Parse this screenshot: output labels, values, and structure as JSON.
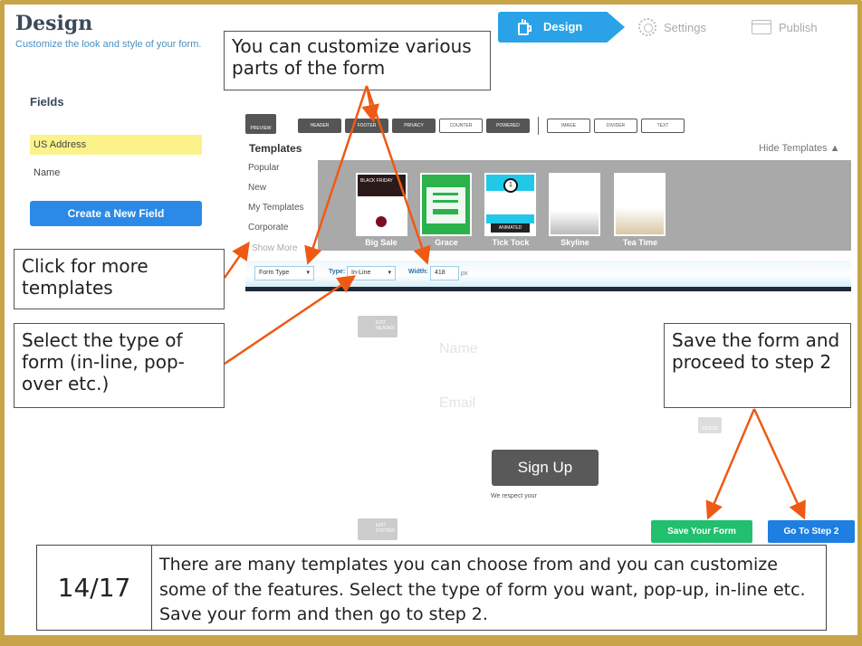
{
  "header": {
    "title": "Design",
    "subtitle": "Customize the look and style of your form."
  },
  "steps": {
    "design": "Design",
    "settings": "Settings",
    "publish": "Publish"
  },
  "callouts": {
    "customize": "You can customize various parts of the form",
    "more_templates": "Click for more templates",
    "form_type": "Select the type of form (in-line, pop-over etc.)",
    "save": "Save the form and proceed to step 2"
  },
  "fields": {
    "heading": "Fields",
    "items": [
      "US Address",
      "Name"
    ],
    "create_label": "Create a New Field"
  },
  "toolbar": {
    "preview": "PREVIEW",
    "buttons": [
      "HEADER",
      "FOOTER",
      "PRIVACY",
      "COUNTER",
      "POWERED",
      "IMAGE",
      "DIVIDER",
      "TEXT"
    ]
  },
  "templates": {
    "heading": "Templates",
    "hide_label": "Hide Templates ▲",
    "categories": [
      "Popular",
      "New",
      "My Templates",
      "Corporate"
    ],
    "show_more": "Show More",
    "thumbs": [
      "Big Sale",
      "Grace",
      "Tick Tock",
      "Skyline",
      "Tea Time"
    ],
    "thumb_texts": {
      "big_sale": "BLACK FRIDAY",
      "tick_tock_badge": "ANIMATED",
      "tick_tock_number": "1"
    }
  },
  "form_options": {
    "form_type": "Form Type",
    "type_label": "Type:",
    "type_value": "In-Line",
    "width_label": "Width:",
    "width_value": "418",
    "width_unit": "px"
  },
  "preview": {
    "edit_header": "EDIT HEADER",
    "name_placeholder": "Name",
    "email_placeholder": "Email",
    "signup": "Sign Up",
    "respect": "We respect your",
    "resize": "RESIZE",
    "edit_footer": "EDIT FOOTER"
  },
  "actions": {
    "save": "Save Your Form",
    "step2": "Go To Step 2"
  },
  "caption": {
    "number": "14/17",
    "text": "There are many templates you can choose from and you can customize some of the features. Select the type of form you want, pop-up, in-line etc. Save your form and then go to step 2."
  },
  "colors": {
    "accent": "#2ba2e8",
    "arrow": "#ee5a14",
    "save_green": "#22bf6e",
    "step2_blue": "#1e7fe0",
    "highlight": "#fbf38a",
    "frame": "#c9a34a"
  }
}
